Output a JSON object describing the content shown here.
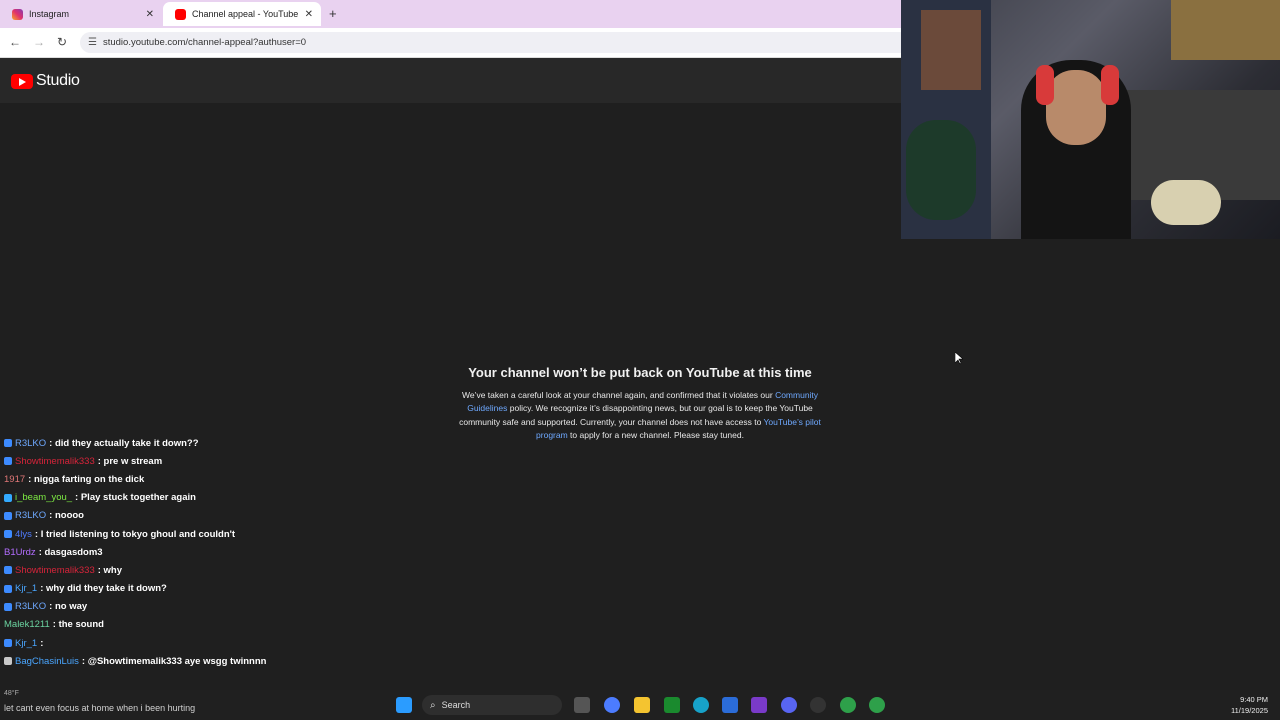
{
  "browser": {
    "tabs": [
      {
        "label": "Instagram"
      },
      {
        "label": "Channel appeal - YouTube"
      }
    ],
    "url": "studio.youtube.com/channel-appeal?authuser=0"
  },
  "studio": {
    "logo_text": "Studio",
    "title": "Your channel won’t be put back on YouTube at this time",
    "msg_part1": "We’ve taken a careful look at your channel again, and confirmed that it violates our ",
    "link1": "Community Guidelines",
    "msg_part2": " policy. We recognize it’s disappointing news, but our goal is to keep the YouTube community safe and supported. Currently, your channel does not have access to ",
    "link2": "YouTube’s pilot program",
    "msg_part3": " to apply for a new channel. Please stay tuned."
  },
  "chat": [
    {
      "user": "R3LKO",
      "color": "#6ea8fe",
      "badge": "#3d8bff",
      "msg": ": did they actually take it down??"
    },
    {
      "user": "Showtimemalik333",
      "color": "#d6243a",
      "badge": "#3d8bff",
      "msg": ": pre w stream"
    },
    {
      "user": "1917",
      "color": "#e07777",
      "badge": "",
      "msg": ": nigga farting on the dick"
    },
    {
      "user": "i_beam_you_",
      "color": "#7dea43",
      "badge": "#33aaff",
      "msg": ": Play stuck together again"
    },
    {
      "user": "R3LKO",
      "color": "#6ea8fe",
      "badge": "#3d8bff",
      "msg": ": noooo"
    },
    {
      "user": "4lys",
      "color": "#4f7cff",
      "badge": "#3d8bff",
      "msg": ": I tried listening to tokyo ghoul and couldn't"
    },
    {
      "user": "B1Urdz",
      "color": "#b36dff",
      "badge": "",
      "msg": ": dasgasdom3"
    },
    {
      "user": "Showtimemalik333",
      "color": "#d6243a",
      "badge": "#3d8bff",
      "msg": ": why"
    },
    {
      "user": "Kjr_1",
      "color": "#4aa6ff",
      "badge": "#3d8bff",
      "msg": ": why did they take it down?"
    },
    {
      "user": "R3LKO",
      "color": "#6ea8fe",
      "badge": "#3d8bff",
      "msg": ": no way"
    },
    {
      "user": "Malek1211",
      "color": "#6bd3a0",
      "badge": "",
      "msg": ": the sound"
    },
    {
      "user": "Kjr_1",
      "color": "#4aa6ff",
      "badge": "#3d8bff",
      "msg": ":"
    },
    {
      "user": "BagChasinLuis",
      "color": "#4aa6ff",
      "badge": "#c9c9c9",
      "msg": ": @Showtimemalik333 aye wsgg twinnnn"
    }
  ],
  "taskbar": {
    "search_label": "Search",
    "time": "9:40 PM",
    "date": "11/19/2025",
    "weather": "48°F",
    "subtitle": "let cant even focus at home when i been hurting"
  },
  "colors": {
    "tabbar": "#e9d2f0",
    "page_bg": "#1f1f1f",
    "link": "#6ea8fe"
  }
}
